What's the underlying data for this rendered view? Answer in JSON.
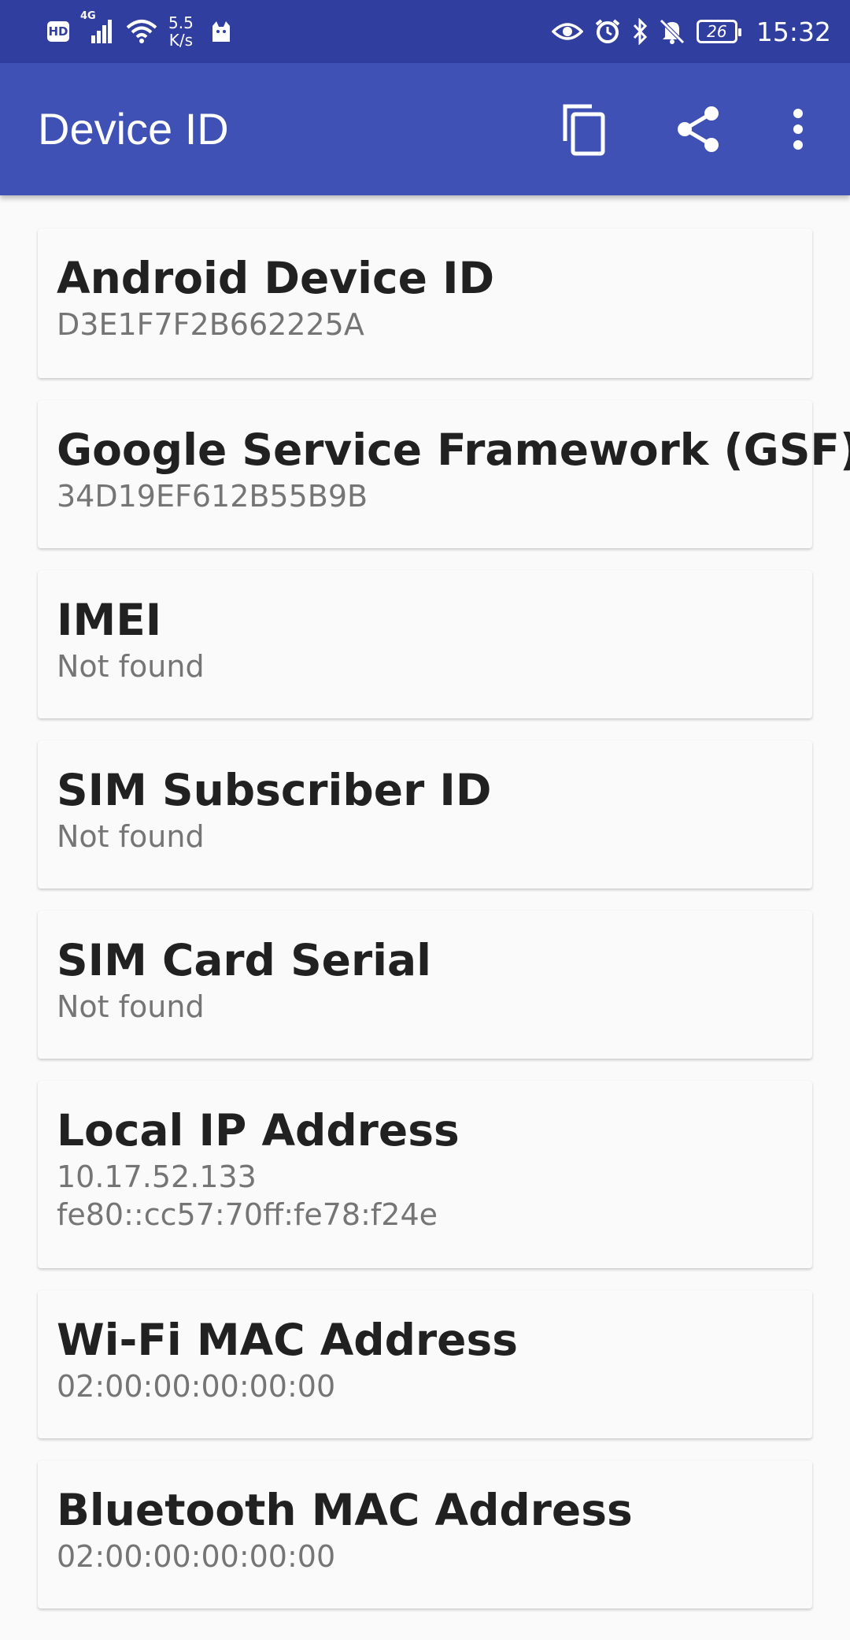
{
  "status_bar": {
    "hd_label": "HD",
    "network_label": "4G",
    "speed_value": "5.5",
    "speed_unit": "K/s",
    "battery": "26",
    "time": "15:32",
    "icons": [
      "hd-icon",
      "signal-icon",
      "wifi-icon",
      "cat-icon",
      "eye-icon",
      "alarm-icon",
      "bluetooth-icon",
      "mute-icon",
      "battery-icon"
    ]
  },
  "app_bar": {
    "title": "Device ID",
    "actions": [
      "copy-icon",
      "share-icon",
      "more-vert-icon"
    ],
    "color": "#3f51b5"
  },
  "items": [
    {
      "title": "Android Device ID",
      "value": "D3E1F7F2B662225A"
    },
    {
      "title": "Google Service Framework (GSF)",
      "value": "34D19EF612B55B9B"
    },
    {
      "title": "IMEI",
      "value": "Not found"
    },
    {
      "title": "SIM Subscriber ID",
      "value": "Not found"
    },
    {
      "title": "SIM Card Serial",
      "value": "Not found"
    },
    {
      "title": "Local IP Address",
      "value": "10.17.52.133",
      "value2": "fe80::cc57:70ff:fe78:f24e"
    },
    {
      "title": "Wi-Fi MAC Address",
      "value": "02:00:00:00:00:00"
    },
    {
      "title": "Bluetooth MAC Address",
      "value": "02:00:00:00:00:00"
    }
  ]
}
